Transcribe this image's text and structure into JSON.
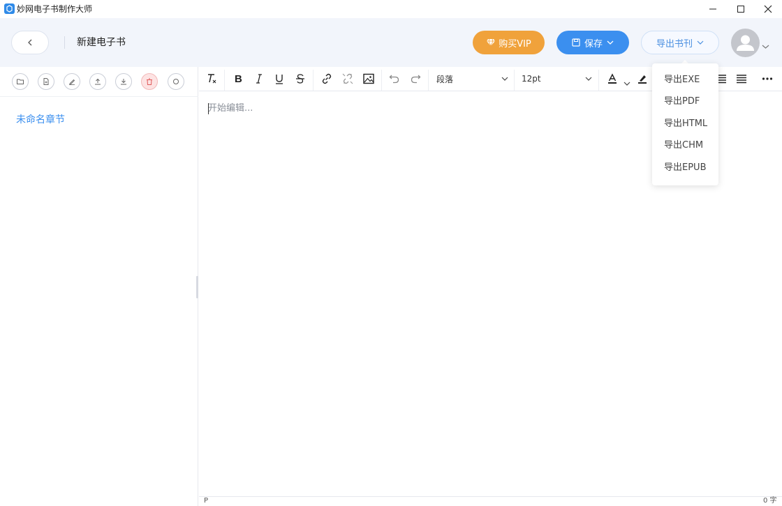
{
  "window": {
    "title": "妙网电子书制作大师"
  },
  "header": {
    "book_title": "新建电子书",
    "vip_label": "购买VIP",
    "save_label": "保存",
    "export_label": "导出书刊"
  },
  "export_menu": {
    "items": [
      "导出EXE",
      "导出PDF",
      "导出HTML",
      "导出CHM",
      "导出EPUB"
    ]
  },
  "sidebar": {
    "tools": [
      "new-folder-icon",
      "new-file-icon",
      "rename-icon",
      "move-up-icon",
      "move-down-icon",
      "delete-icon",
      "search-icon"
    ],
    "chapters": [
      "未命名章节"
    ]
  },
  "editor": {
    "toolbar": {
      "block_format": "段落",
      "font_size": "12pt"
    },
    "placeholder": "开始编辑...",
    "status_path": "P",
    "word_count": "0 字"
  },
  "colors": {
    "vip": "#f0a23b",
    "primary": "#3b8fef",
    "header_bg": "#f2f5fb",
    "danger_bg": "#fde3e3"
  }
}
